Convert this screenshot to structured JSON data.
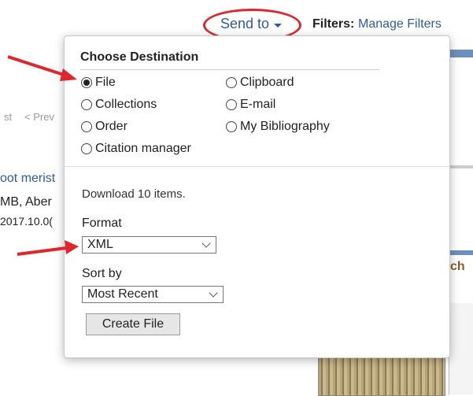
{
  "header": {
    "send_to_label": "Send to",
    "filters_label": "Filters:",
    "manage_filters_label": "Manage Filters"
  },
  "background": {
    "first_fragment": "st",
    "prev_fragment": "< Prev",
    "result_title_fragment": "oot merist",
    "authors_fragment": "MB, Aber",
    "date_fragment": "2017.10.0(",
    "right_heading_fragment": "ch"
  },
  "popup": {
    "heading": "Choose Destination",
    "destinations": [
      {
        "label": "File",
        "checked": true
      },
      {
        "label": "Clipboard",
        "checked": false
      },
      {
        "label": "Collections",
        "checked": false
      },
      {
        "label": "E-mail",
        "checked": false
      },
      {
        "label": "Order",
        "checked": false
      },
      {
        "label": "My Bibliography",
        "checked": false
      },
      {
        "label": "Citation manager",
        "checked": false
      }
    ],
    "download_text": "Download 10 items.",
    "format_label": "Format",
    "format_value": "XML",
    "sort_label": "Sort by",
    "sort_value": "Most Recent",
    "create_button_label": "Create File"
  },
  "colors": {
    "link_blue": "#2f5aa0",
    "annotation_red": "#e0262c"
  }
}
